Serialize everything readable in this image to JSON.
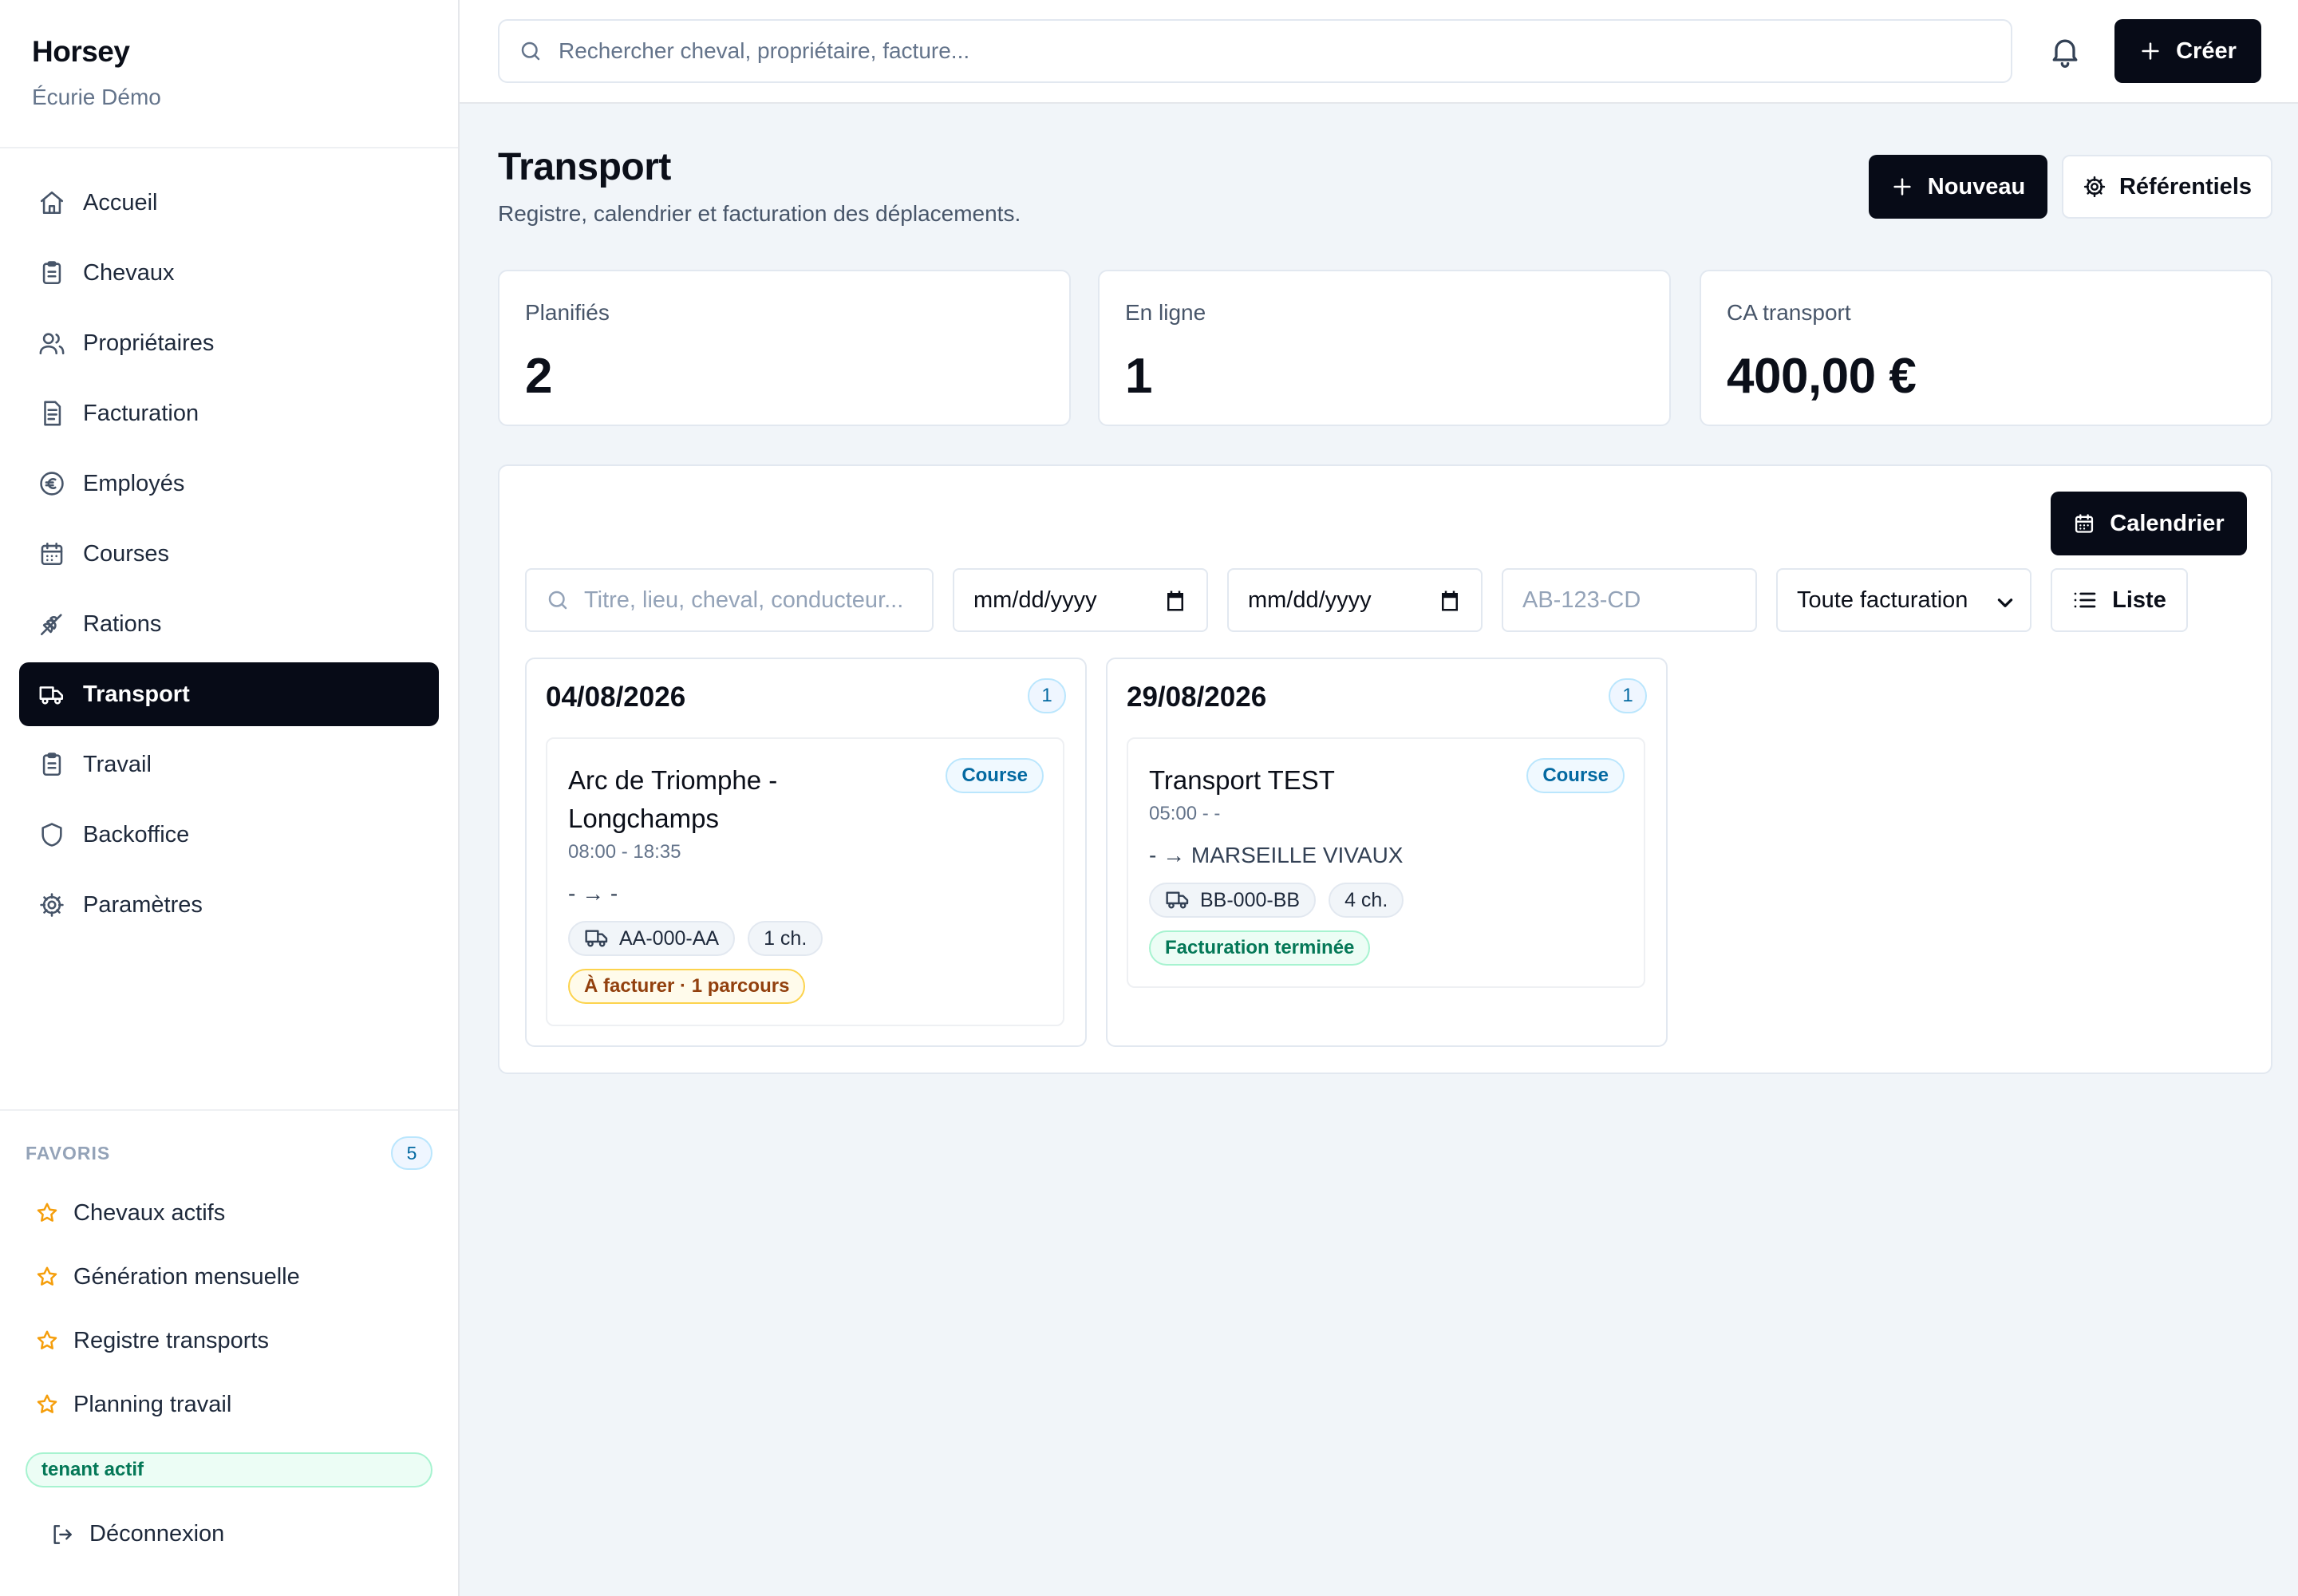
{
  "app": {
    "name": "Horsey",
    "stable": "Écurie Démo"
  },
  "sidebar": {
    "items": [
      {
        "label": "Accueil"
      },
      {
        "label": "Chevaux"
      },
      {
        "label": "Propriétaires"
      },
      {
        "label": "Facturation"
      },
      {
        "label": "Employés"
      },
      {
        "label": "Courses"
      },
      {
        "label": "Rations"
      },
      {
        "label": "Transport",
        "active": true
      },
      {
        "label": "Travail"
      },
      {
        "label": "Backoffice"
      },
      {
        "label": "Paramètres"
      }
    ],
    "favorites": {
      "title": "FAVORIS",
      "count": "5",
      "items": [
        {
          "label": "Chevaux actifs"
        },
        {
          "label": "Génération mensuelle"
        },
        {
          "label": "Registre transports"
        },
        {
          "label": "Planning travail"
        }
      ]
    },
    "tenant_badge": "tenant actif",
    "logout_label": "Déconnexion"
  },
  "topbar": {
    "search_placeholder": "Rechercher cheval, propriétaire, facture...",
    "create_label": "Créer"
  },
  "page": {
    "title": "Transport",
    "subtitle": "Registre, calendrier et facturation des déplacements.",
    "new_label": "Nouveau",
    "referentials_label": "Référentiels"
  },
  "stats": [
    {
      "label": "Planifiés",
      "value": "2"
    },
    {
      "label": "En ligne",
      "value": "1"
    },
    {
      "label": "CA transport",
      "value": "400,00 €"
    }
  ],
  "panel": {
    "calendar_label": "Calendrier",
    "filters": {
      "search_placeholder": "Titre, lieu, cheval, conducteur...",
      "date_from": "mm/dd/yyyy",
      "date_to": "mm/dd/yyyy",
      "plate_placeholder": "AB-123-CD",
      "billing_select": "Toute facturation",
      "list_label": "Liste"
    },
    "days": [
      {
        "date": "04/08/2026",
        "count": "1",
        "trip": {
          "title": "Arc de Triomphe - Longchamps",
          "type": "Course",
          "time": "08:00 - 18:35",
          "route": "- → -",
          "plate": "AA-000-AA",
          "capacity": "1 ch.",
          "status": "À facturer · 1 parcours"
        }
      },
      {
        "date": "29/08/2026",
        "count": "1",
        "trip": {
          "title": "Transport TEST",
          "type": "Course",
          "time": "05:00 - -",
          "route": "- → MARSEILLE VIVAUX",
          "plate": "BB-000-BB",
          "capacity": "4 ch.",
          "status": "Facturation terminée"
        }
      }
    ]
  },
  "colors": {
    "primary": "#070b17",
    "background": "#f1f5f9",
    "favorite_star": "#f59e0b",
    "badge_blue": "#0369a1",
    "status_pending": "#92400e",
    "status_done": "#047857"
  }
}
